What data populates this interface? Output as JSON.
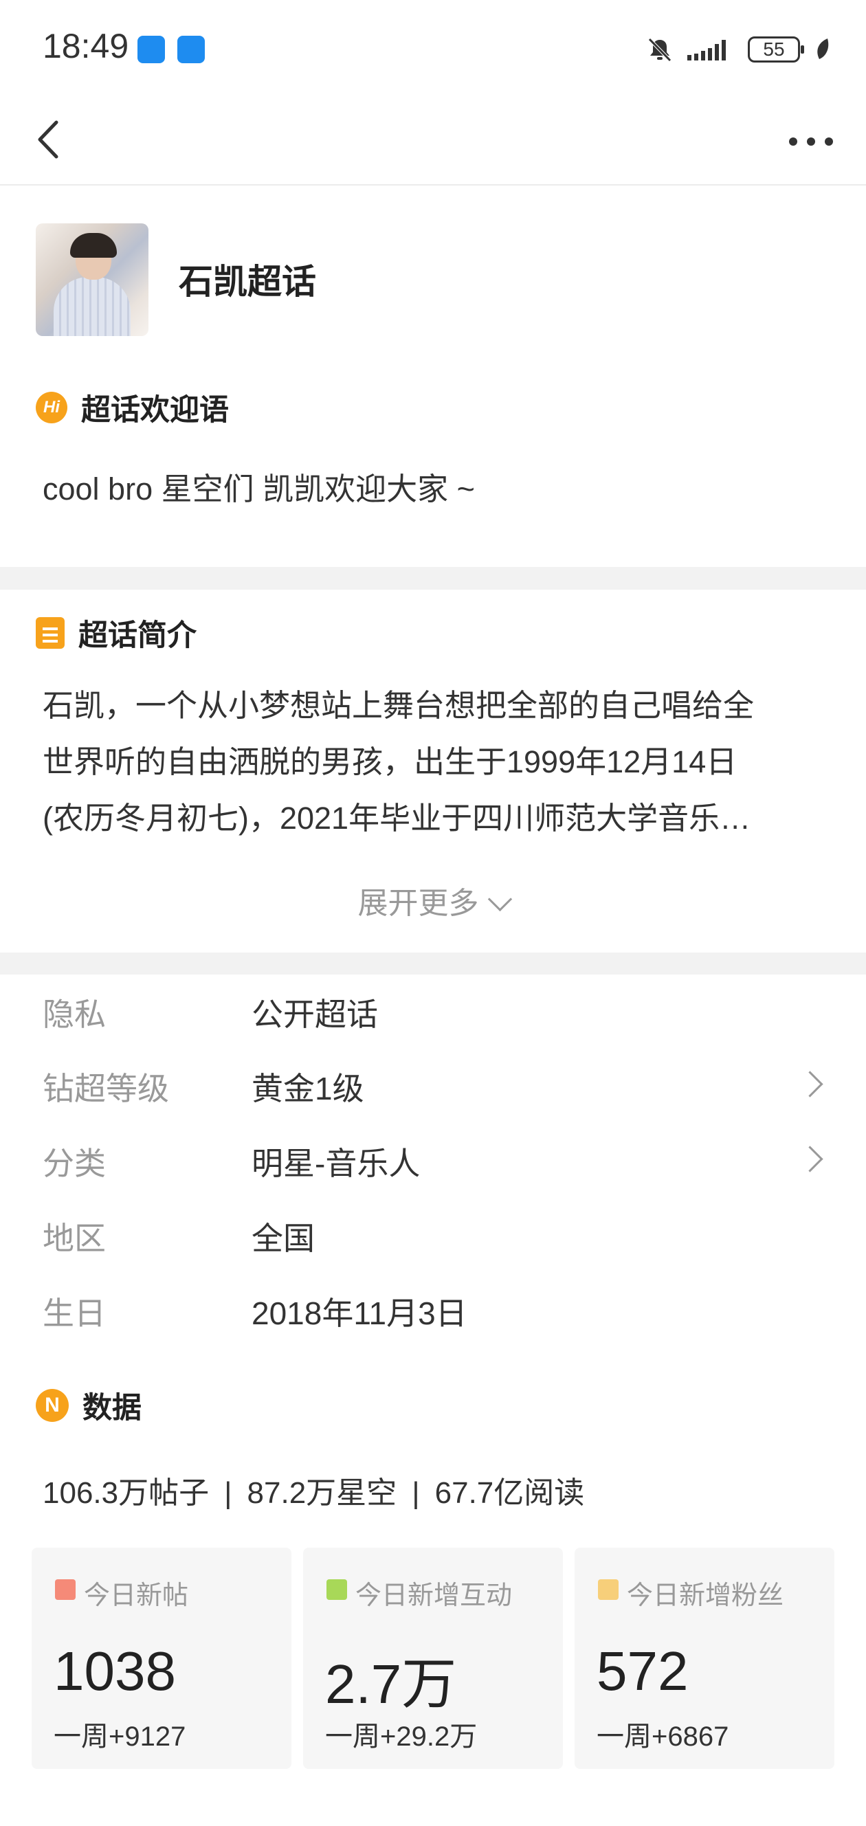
{
  "status_bar": {
    "time": "18:49",
    "battery": "55"
  },
  "header": {
    "title": "石凯超话"
  },
  "welcome": {
    "label": "超话欢迎语",
    "text": "cool bro 星空们 凯凯欢迎大家 ~"
  },
  "intro": {
    "label": "超话简介",
    "lines": [
      "石凯，一个从小梦想站上舞台想把全部的自己唱给全",
      "世界听的自由洒脱的男孩，出生于1999年12月14日",
      "(农历冬月初七)，2021年毕业于四川师范大学音乐…"
    ],
    "expand_label": "展开更多"
  },
  "info": [
    {
      "key": "隐私",
      "value": "公开超话"
    },
    {
      "key": "钻超等级",
      "value": "黄金1级"
    },
    {
      "key": "分类",
      "value": "明星-音乐人"
    },
    {
      "key": "地区",
      "value": "全国"
    },
    {
      "key": "生日",
      "value": "2018年11月3日"
    }
  ],
  "data_section": {
    "label": "数据",
    "posts": "106.3万帖子",
    "fans": "87.2万星空",
    "reads": "67.7亿阅读",
    "separator": "|",
    "tiles": [
      {
        "label": "今日新帖",
        "value": "1038",
        "week": "一周+9127",
        "color": "#f58a78"
      },
      {
        "label": "今日新增互动",
        "value": "2.7万",
        "week": "一周+29.2万",
        "color": "#a8d858"
      },
      {
        "label": "今日新增粉丝",
        "value": "572",
        "week": "一周+6867",
        "color": "#f7cf7a"
      }
    ]
  },
  "icons": {
    "back": "back-arrow-icon",
    "more": "more-dots-icon",
    "welcome": "hi-icon",
    "intro": "document-icon",
    "data": "data-n-icon"
  }
}
